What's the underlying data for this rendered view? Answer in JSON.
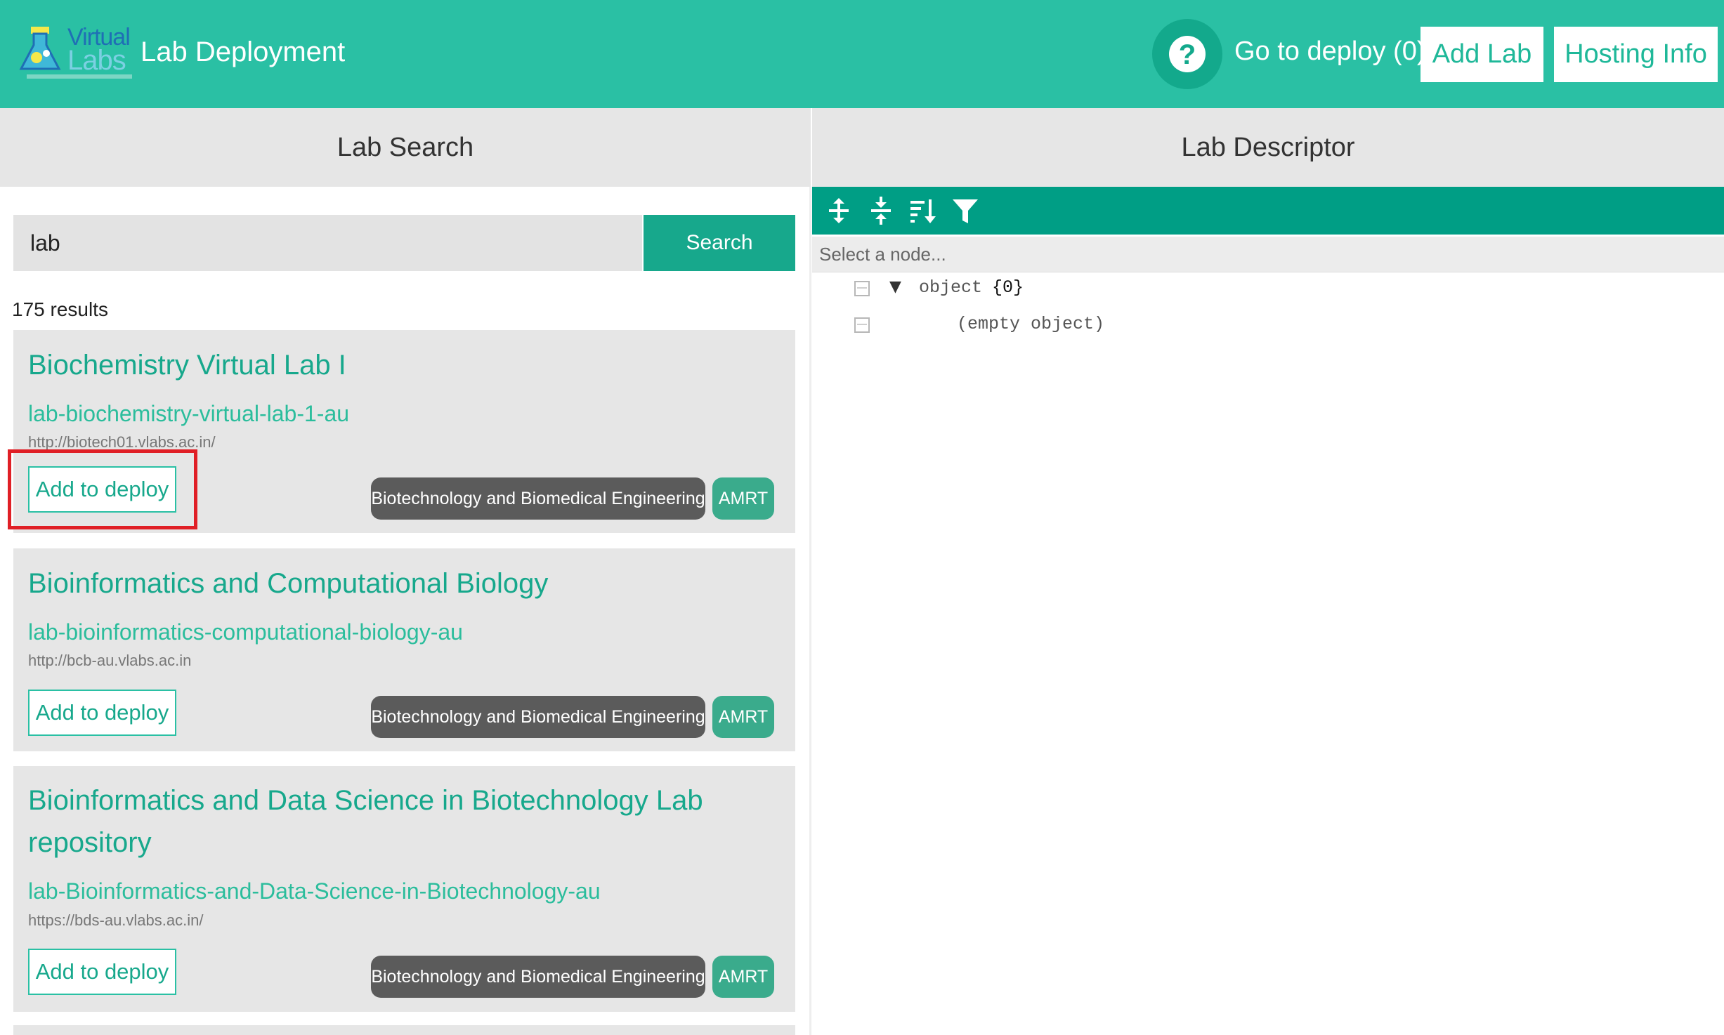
{
  "header": {
    "logo_word1": "Virtual",
    "logo_word2": "Labs",
    "app_title": "Lab Deployment",
    "help_label": "?",
    "goto_deploy": "Go to deploy (0)",
    "add_lab": "Add Lab",
    "hosting_info": "Hosting Info"
  },
  "left_panel": {
    "title": "Lab Search",
    "search_value": "lab",
    "search_button": "Search",
    "results_count": "175 results",
    "cards": [
      {
        "title": "Biochemistry Virtual Lab I",
        "slug": "lab-biochemistry-virtual-lab-1-au",
        "url": "http://biotech01.vlabs.ac.in/",
        "deploy_label": "Add to deploy",
        "discipline": "Biotechnology and Biomedical Engineering",
        "institute": "AMRT",
        "highlighted": true
      },
      {
        "title": "Bioinformatics and Computational Biology",
        "slug": "lab-bioinformatics-computational-biology-au",
        "url": "http://bcb-au.vlabs.ac.in",
        "deploy_label": "Add to deploy",
        "discipline": "Biotechnology and Biomedical Engineering",
        "institute": "AMRT",
        "highlighted": false
      },
      {
        "title": "Bioinformatics and Data Science in Biotechnology Lab repository",
        "slug": "lab-Bioinformatics-and-Data-Science-in-Biotechnology-au",
        "url": "https://bds-au.vlabs.ac.in/",
        "deploy_label": "Add to deploy",
        "discipline": "Biotechnology and Biomedical Engineering",
        "institute": "AMRT",
        "highlighted": false
      }
    ]
  },
  "right_panel": {
    "title": "Lab Descriptor",
    "toolbar_icons": [
      "expand-all-icon",
      "collapse-all-icon",
      "sort-icon",
      "filter-icon"
    ],
    "node_placeholder": "Select a node...",
    "tree": {
      "root_field": "object",
      "root_value": "{0}",
      "empty_label": "(empty object)"
    }
  },
  "colors": {
    "header_bg": "#2ac0a4",
    "accent": "#17a88c",
    "toolbar_bg": "#009e85",
    "discipline_tag": "#5b5b5b",
    "institute_tag": "#3aab8c",
    "highlight_box": "#e01f26"
  }
}
